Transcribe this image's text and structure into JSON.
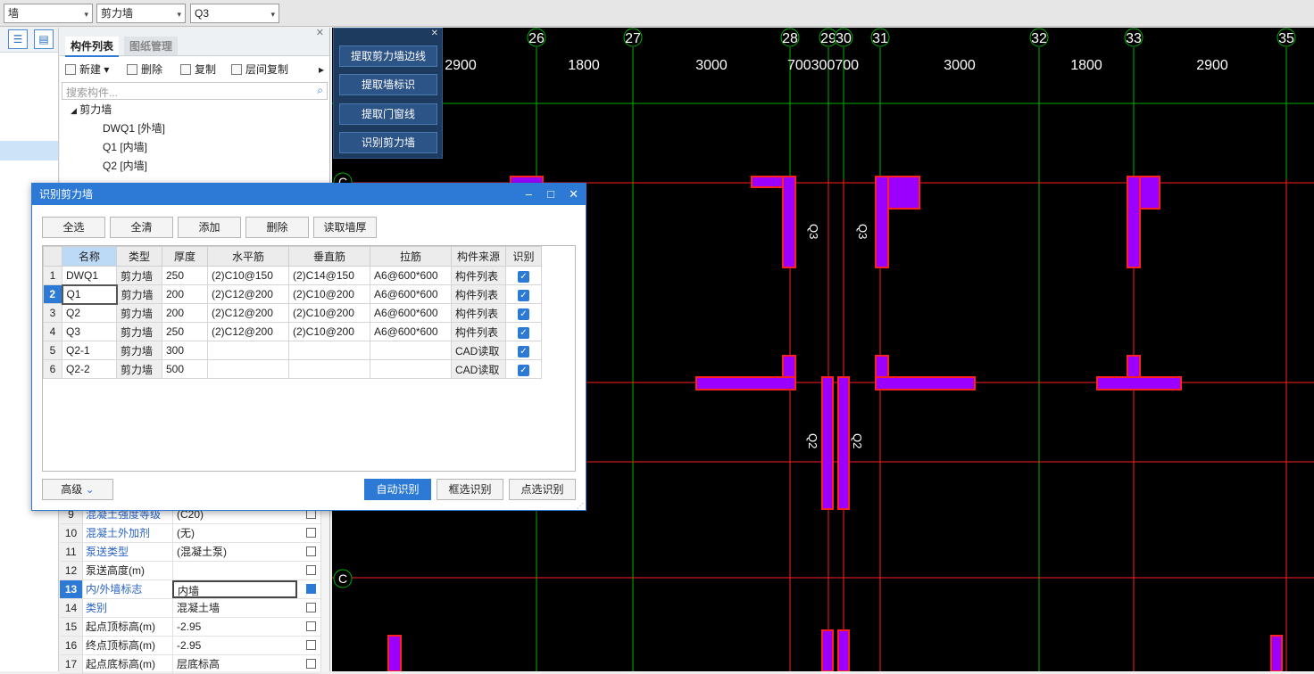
{
  "topbar": {
    "sel1": "墙",
    "sel2": "剪力墙",
    "sel3": "Q3"
  },
  "panel": {
    "tabs": [
      "构件列表",
      "图纸管理"
    ],
    "tools": [
      "新建",
      "删除",
      "复制",
      "层间复制"
    ],
    "search_placeholder": "搜索构件...",
    "tree_root": "剪力墙",
    "tree_items": [
      "DWQ1 [外墙]",
      "Q1 [内墙]",
      "Q2 [内墙]"
    ],
    "props": [
      {
        "n": "9",
        "k": "混凝土强度等级",
        "v": "(C20)",
        "blue": true
      },
      {
        "n": "10",
        "k": "混凝土外加剂",
        "v": "(无)",
        "blue": true
      },
      {
        "n": "11",
        "k": "泵送类型",
        "v": "(混凝土泵)",
        "blue": true
      },
      {
        "n": "12",
        "k": "泵送高度(m)",
        "v": "",
        "blue": false
      },
      {
        "n": "13",
        "k": "内/外墙标志",
        "v": "内墙",
        "blue": true
      },
      {
        "n": "14",
        "k": "类别",
        "v": "混凝土墙",
        "blue": true
      },
      {
        "n": "15",
        "k": "起点顶标高(m)",
        "v": "-2.95",
        "blue": false
      },
      {
        "n": "16",
        "k": "终点顶标高(m)",
        "v": "-2.95",
        "blue": false
      },
      {
        "n": "17",
        "k": "起点底标高(m)",
        "v": "层底标高",
        "blue": false
      }
    ]
  },
  "floatmenu": [
    "提取剪力墙边线",
    "提取墙标识",
    "提取门窗线",
    "识别剪力墙"
  ],
  "dialog": {
    "title": "识别剪力墙",
    "buttons": [
      "全选",
      "全清",
      "添加",
      "删除",
      "读取墙厚"
    ],
    "columns": [
      "名称",
      "类型",
      "厚度",
      "水平筋",
      "垂直筋",
      "拉筋",
      "构件来源",
      "识别"
    ],
    "rows": [
      {
        "no": "1",
        "name": "DWQ1",
        "type": "剪力墙",
        "thk": "250",
        "h": "(2)C10@150",
        "v": "(2)C14@150",
        "tie": "A6@600*600",
        "src": "构件列表"
      },
      {
        "no": "2",
        "name": "Q1",
        "type": "剪力墙",
        "thk": "200",
        "h": "(2)C12@200",
        "v": "(2)C10@200",
        "tie": "A6@600*600",
        "src": "构件列表"
      },
      {
        "no": "3",
        "name": "Q2",
        "type": "剪力墙",
        "thk": "200",
        "h": "(2)C12@200",
        "v": "(2)C10@200",
        "tie": "A6@600*600",
        "src": "构件列表"
      },
      {
        "no": "4",
        "name": "Q3",
        "type": "剪力墙",
        "thk": "250",
        "h": "(2)C12@200",
        "v": "(2)C10@200",
        "tie": "A6@600*600",
        "src": "构件列表"
      },
      {
        "no": "5",
        "name": "Q2-1",
        "type": "剪力墙",
        "thk": "300",
        "h": "",
        "v": "",
        "tie": "",
        "src": "CAD读取"
      },
      {
        "no": "6",
        "name": "Q2-2",
        "type": "剪力墙",
        "thk": "500",
        "h": "",
        "v": "",
        "tie": "",
        "src": "CAD读取"
      }
    ],
    "advanced": "高级",
    "footer": [
      "自动识别",
      "框选识别",
      "点选识别"
    ]
  },
  "cad": {
    "axes": [
      "26",
      "27",
      "28",
      "29",
      "30",
      "31",
      "32",
      "33",
      "35"
    ],
    "dims": [
      "2900",
      "1800",
      "3000",
      "700300700",
      "3000",
      "1800",
      "2900"
    ],
    "row_axis": "C",
    "labels": [
      "Q3",
      "Q3",
      "Q2",
      "Q2"
    ]
  },
  "colors": {
    "accent": "#2d7ad6",
    "wall_fill": "#9b00ff",
    "wall_edge": "#ff2020",
    "axis": "#00b000"
  }
}
